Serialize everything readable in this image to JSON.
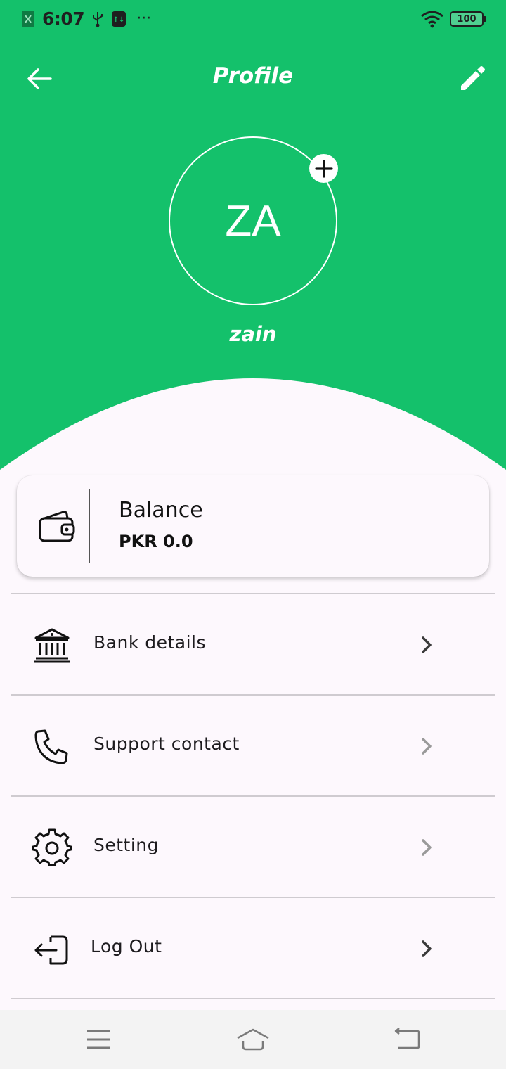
{
  "colors": {
    "brand_green": "#14c16b",
    "background": "#fdf8fd",
    "chevron_dark": "#3a3a3a",
    "chevron_light": "#9a9a9a"
  },
  "status_bar": {
    "time": "6:07",
    "overflow": "···",
    "battery": "100",
    "icons": [
      "app-notification-icon",
      "usb-icon",
      "data-transfer-icon",
      "wifi-icon",
      "battery-icon"
    ]
  },
  "app_bar": {
    "title": "Profile",
    "back_icon": "arrow-left-icon",
    "edit_icon": "pencil-icon"
  },
  "profile": {
    "initials": "ZA",
    "name": "zain",
    "add_photo_icon": "plus-icon"
  },
  "balance_card": {
    "label": "Balance",
    "value": "PKR 0.0",
    "icon": "wallet-icon"
  },
  "menu": {
    "items": [
      {
        "label": "Bank details",
        "icon": "bank-icon",
        "chevron": "dark"
      },
      {
        "label": "Support contact",
        "icon": "phone-icon",
        "chevron": "light"
      },
      {
        "label": "Setting",
        "icon": "gear-icon",
        "chevron": "light"
      },
      {
        "label": "Log Out",
        "icon": "logout-icon",
        "chevron": "dark"
      }
    ]
  },
  "nav_bar": {
    "buttons": [
      "menu-icon",
      "home-icon",
      "back-icon"
    ]
  }
}
